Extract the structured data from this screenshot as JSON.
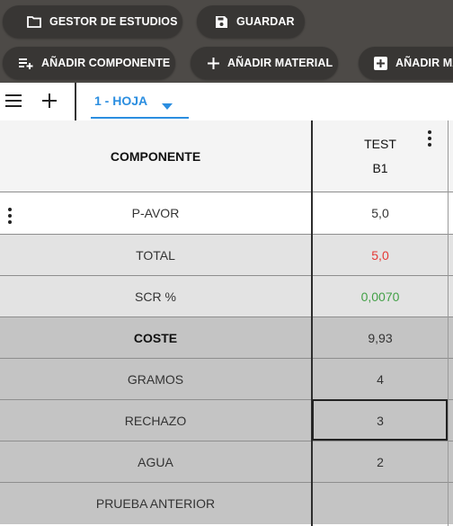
{
  "toolbar": {
    "buttons": [
      {
        "label": "GESTOR DE ESTUDIOS",
        "icon": "folder-icon"
      },
      {
        "label": "GUARDAR",
        "icon": "save-icon"
      },
      {
        "label": "AÑADIR COMPONENTE",
        "icon": "playlist-add-icon"
      },
      {
        "label": "AÑADIR MATERIAL",
        "icon": "plus-icon"
      },
      {
        "label": "AÑADIR MA",
        "icon": "add-box-icon"
      }
    ]
  },
  "tabs": {
    "menu_icon": "menu-icon",
    "add_icon": "plus-icon",
    "active": {
      "label": "1 - HOJA",
      "icon": "caret-down-icon"
    }
  },
  "grid": {
    "header": {
      "component": "COMPONENTE",
      "col_title": "TEST",
      "col_sub": "B1"
    },
    "rows": [
      {
        "label": "P-AVOR",
        "value": "5,0",
        "bg": "#ffffff",
        "value_color": "#333333",
        "bold": false
      },
      {
        "label": "TOTAL",
        "value": "5,0",
        "bg": "#e3e3e3",
        "value_color": "#e53935",
        "bold": false
      },
      {
        "label": "SCR %",
        "value": "0,0070",
        "bg": "#e3e3e3",
        "value_color": "#43a047",
        "bold": false
      },
      {
        "label": "COSTE",
        "value": "9,93",
        "bg": "#c4c4c4",
        "value_color": "#333333",
        "bold": true
      },
      {
        "label": "GRAMOS",
        "value": "4",
        "bg": "#c4c4c4",
        "value_color": "#333333",
        "bold": false
      },
      {
        "label": "RECHAZO",
        "value": "3",
        "bg": "#c4c4c4",
        "value_color": "#333333",
        "bold": false
      },
      {
        "label": "AGUA",
        "value": "2",
        "bg": "#c4c4c4",
        "value_color": "#333333",
        "bold": false
      },
      {
        "label": "PRUEBA ANTERIOR",
        "value": "",
        "bg": "#c4c4c4",
        "value_color": "#333333",
        "bold": false
      }
    ]
  }
}
